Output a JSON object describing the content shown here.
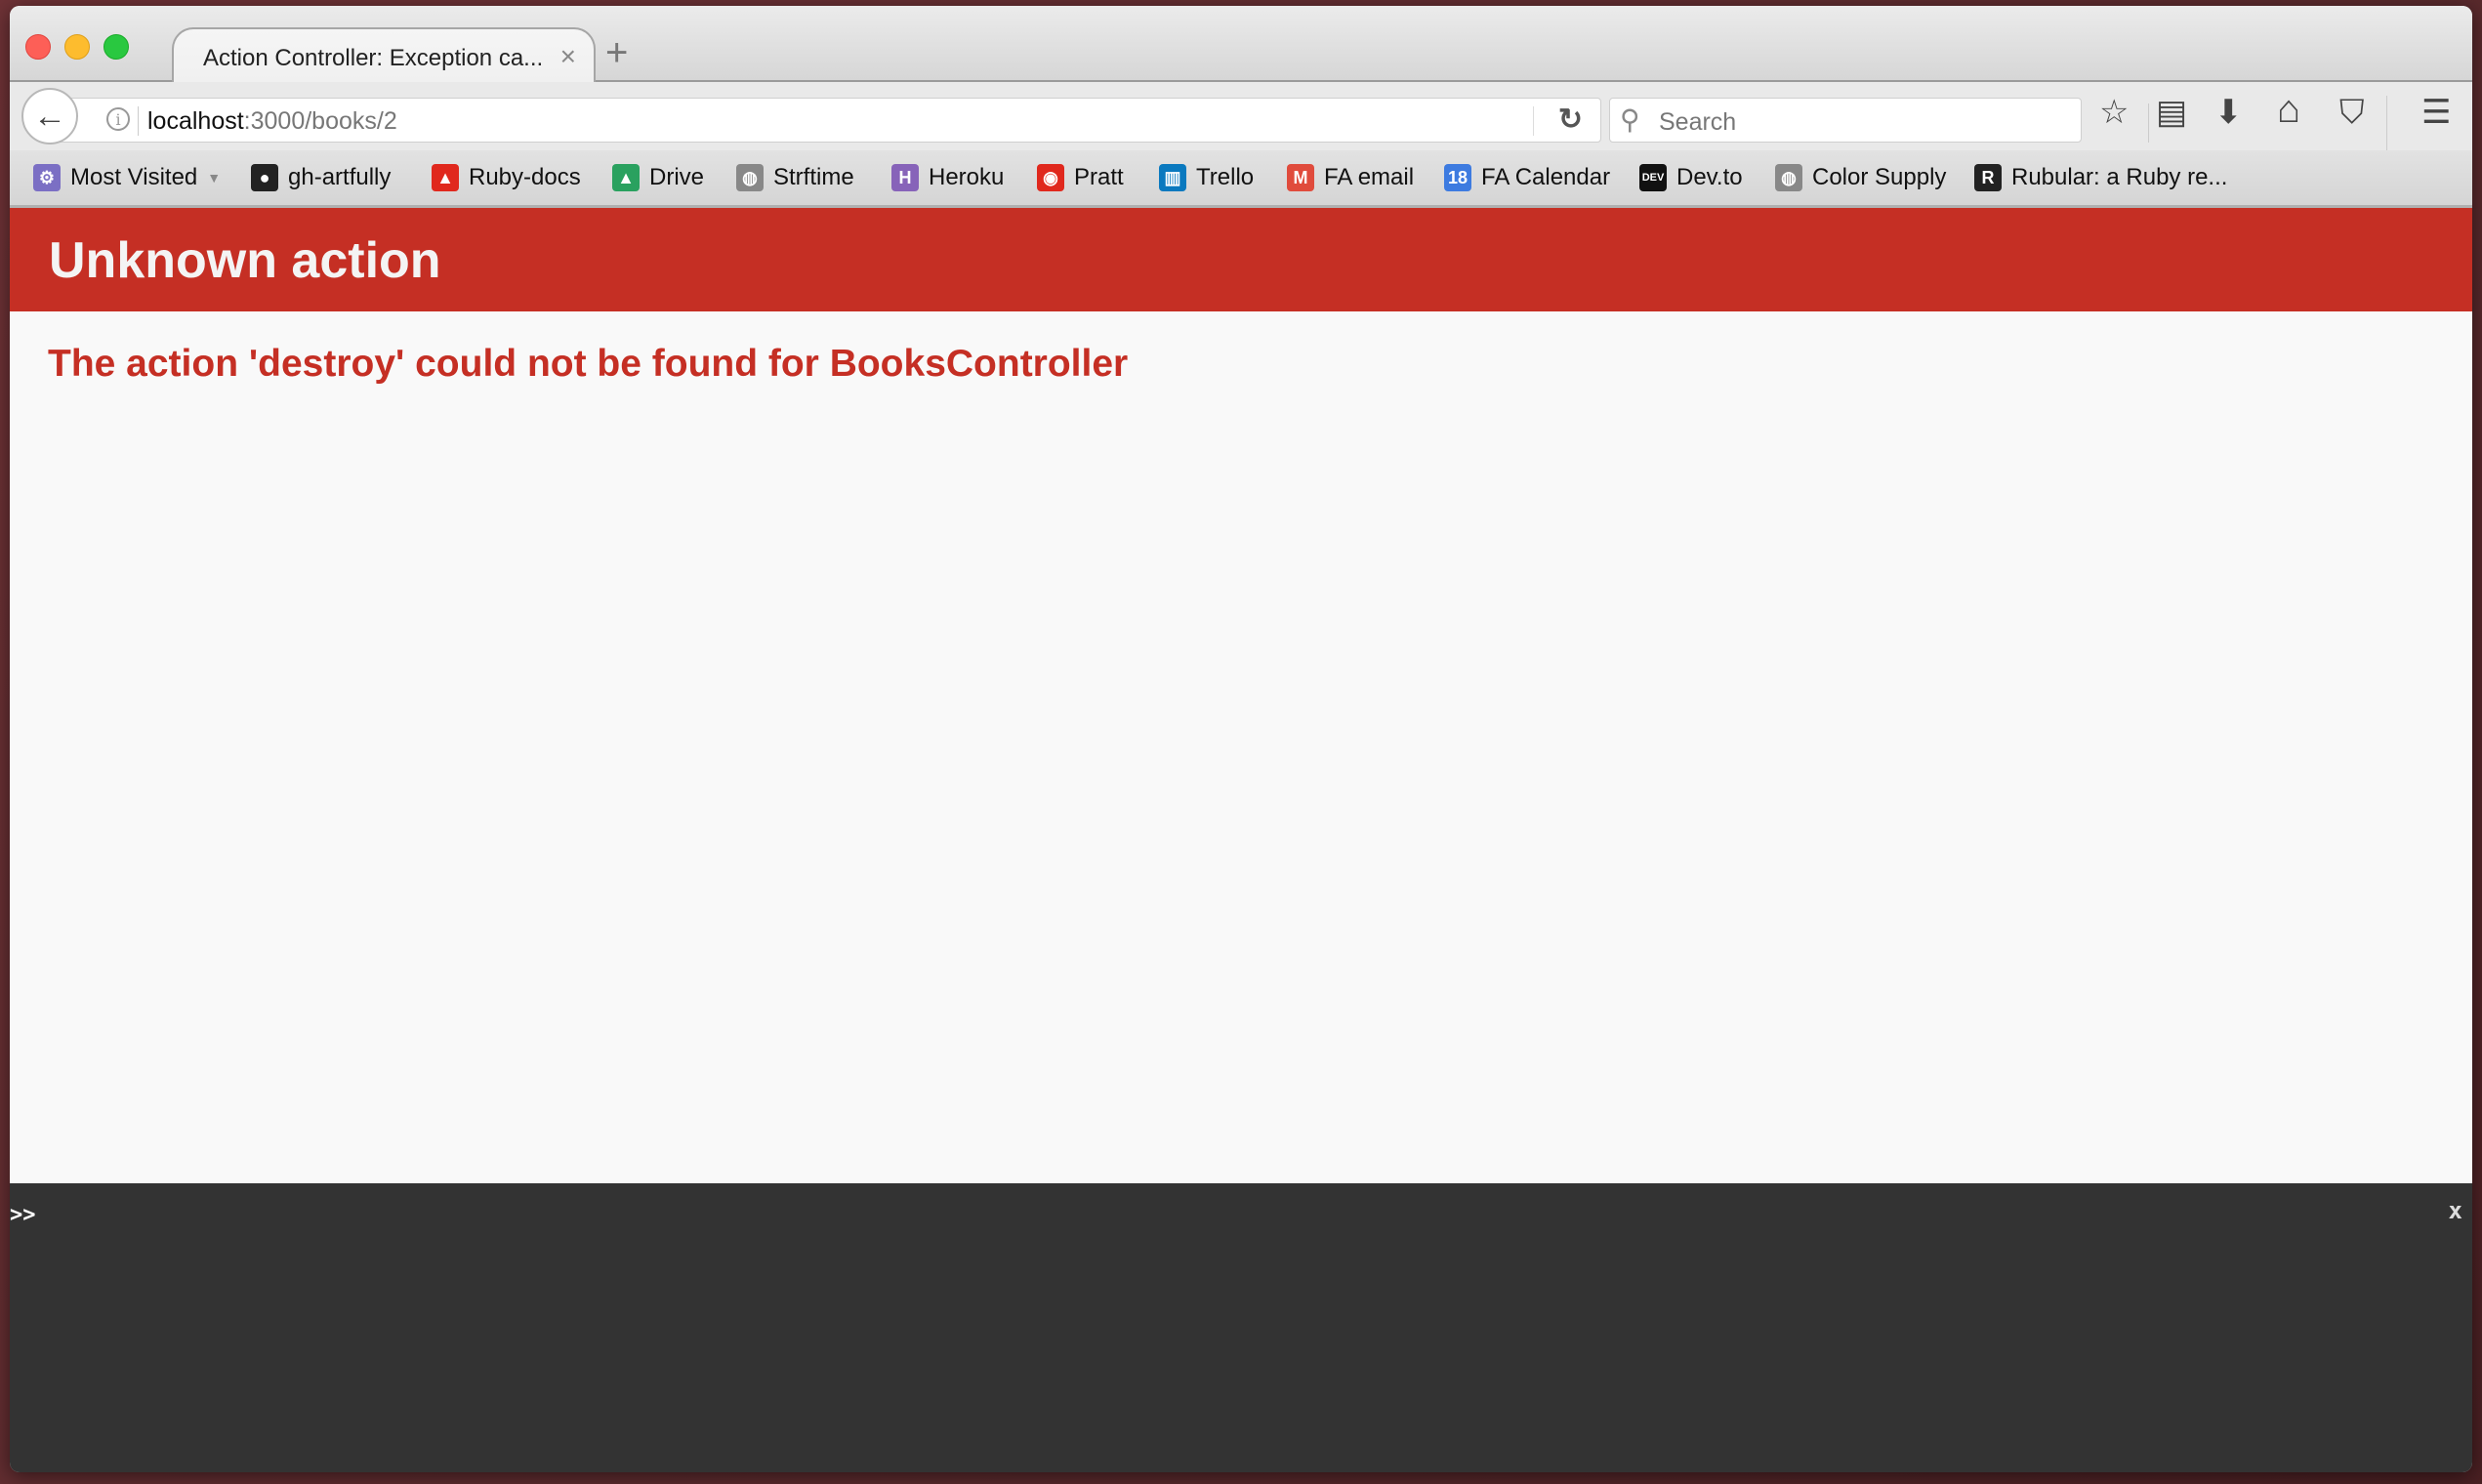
{
  "browser": {
    "tab": {
      "title": "Action Controller: Exception ca...",
      "close_glyph": "×"
    },
    "new_tab_glyph": "+",
    "nav": {
      "back_glyph": "←",
      "url_host": "localhost",
      "url_rest": ":3000/books/2",
      "info_glyph": "i",
      "reload_glyph": "↻",
      "search_placeholder": "Search",
      "search_glyph": "⚲"
    },
    "toolbar_icons": [
      {
        "name": "bookmark-star-icon",
        "glyph": "☆"
      },
      {
        "name": "bookmarks-list-icon",
        "glyph": "▤"
      },
      {
        "name": "downloads-icon",
        "glyph": "⬇"
      },
      {
        "name": "home-icon",
        "glyph": "⌂"
      },
      {
        "name": "pocket-icon",
        "glyph": "⛉"
      },
      {
        "name": "menu-icon",
        "glyph": "☰"
      }
    ],
    "bookmarks": [
      {
        "label": "Most Visited",
        "icon": "folder-icon",
        "glyph": "⚙",
        "color": "#7b6fc4"
      },
      {
        "label": "gh-artfully",
        "icon": "github-icon",
        "glyph": "●",
        "color": "#222222"
      },
      {
        "label": "Ruby-docs",
        "icon": "ruby-icon",
        "glyph": "▲",
        "color": "#e0281d"
      },
      {
        "label": "Drive",
        "icon": "drive-icon",
        "glyph": "▲",
        "color": "#2aa15f"
      },
      {
        "label": "Strftime",
        "icon": "globe-icon",
        "glyph": "◍",
        "color": "#888888"
      },
      {
        "label": "Heroku",
        "icon": "heroku-icon",
        "glyph": "H",
        "color": "#8763b9"
      },
      {
        "label": "Pratt",
        "icon": "pratt-icon",
        "glyph": "◉",
        "color": "#e0281d"
      },
      {
        "label": "Trello",
        "icon": "trello-icon",
        "glyph": "▥",
        "color": "#0a79bf"
      },
      {
        "label": "FA email",
        "icon": "gmail-icon",
        "glyph": "M",
        "color": "#e04b3c"
      },
      {
        "label": "FA Calendar",
        "icon": "calendar-icon",
        "glyph": "18",
        "color": "#3d7be0"
      },
      {
        "label": "Dev.to",
        "icon": "devto-icon",
        "glyph": "DEV",
        "color": "#111111"
      },
      {
        "label": "Color Supply",
        "icon": "globe-icon",
        "glyph": "◍",
        "color": "#888888"
      },
      {
        "label": "Rubular: a Ruby re...",
        "icon": "rubular-icon",
        "glyph": "R",
        "color": "#222222"
      }
    ]
  },
  "page": {
    "title": "Unknown action",
    "message": "The action 'destroy' could not be found for BooksController",
    "accent_color": "#c52f24"
  },
  "console": {
    "prompt": ">>",
    "input_value": "",
    "close_label": "x"
  }
}
